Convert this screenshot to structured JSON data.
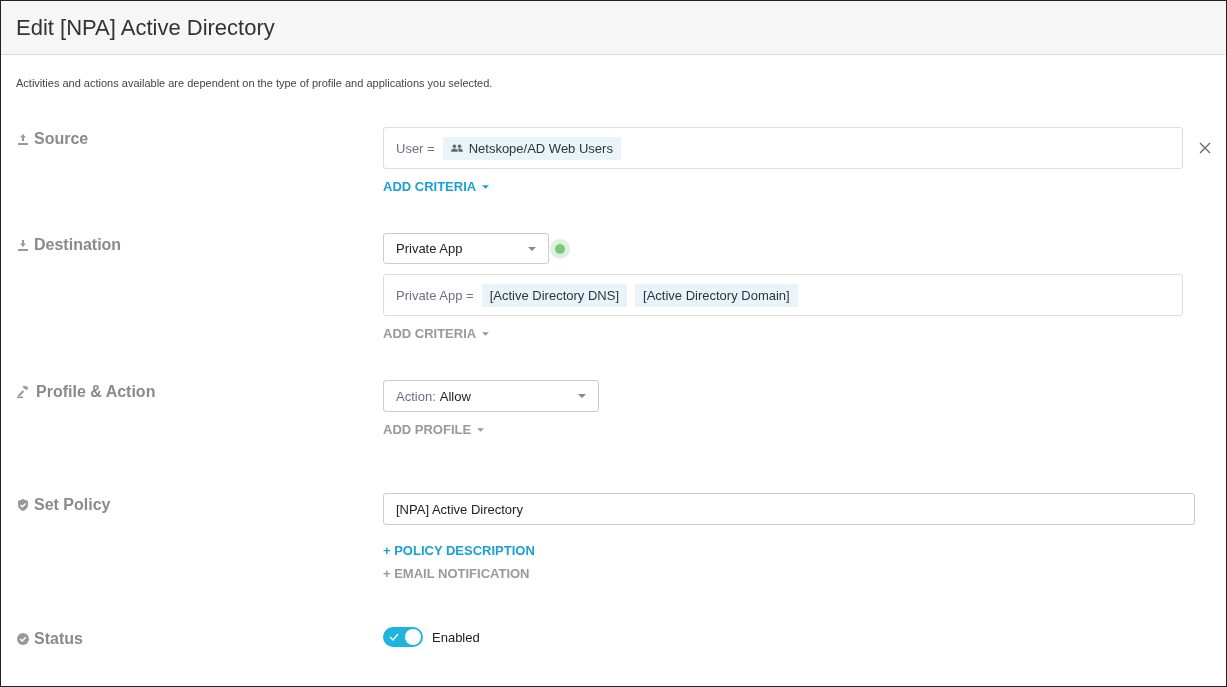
{
  "title": "Edit [NPA] Active Directory",
  "description": "Activities and actions available are dependent on the type of profile and applications you selected.",
  "sections": [
    {
      "kind": "source",
      "label": "Source",
      "criteria": {
        "label": "User =",
        "removable": true,
        "chips": [
          {
            "text": "Netskope/AD Web Users",
            "kind": "group"
          }
        ]
      },
      "add": {
        "text": "ADD CRITERIA",
        "active": true
      }
    },
    {
      "kind": "destination",
      "label": "Destination",
      "select": {
        "value": "Private App",
        "hotspot": true
      },
      "criteria": {
        "label": "Private App =",
        "removable": false,
        "chips": [
          {
            "text": "[Active Directory DNS]",
            "kind": "app"
          },
          {
            "text": "[Active Directory Domain]",
            "kind": "app"
          }
        ]
      },
      "add": {
        "text": "ADD CRITERIA",
        "active": false
      }
    },
    {
      "kind": "profile",
      "label": "Profile & Action",
      "select": {
        "label": "Action:",
        "value": "Allow",
        "hotspot": false
      },
      "add": {
        "text": "ADD PROFILE",
        "active": false
      }
    },
    {
      "kind": "policy",
      "label": "Set Policy",
      "input": "[NPA] Active Directory",
      "links": [
        {
          "text": "+ POLICY DESCRIPTION",
          "active": true
        },
        {
          "text": "+ EMAIL NOTIFICATION",
          "active": false
        }
      ]
    },
    {
      "kind": "status",
      "label": "Status",
      "toggle": {
        "on": true,
        "label": "Enabled"
      }
    }
  ]
}
